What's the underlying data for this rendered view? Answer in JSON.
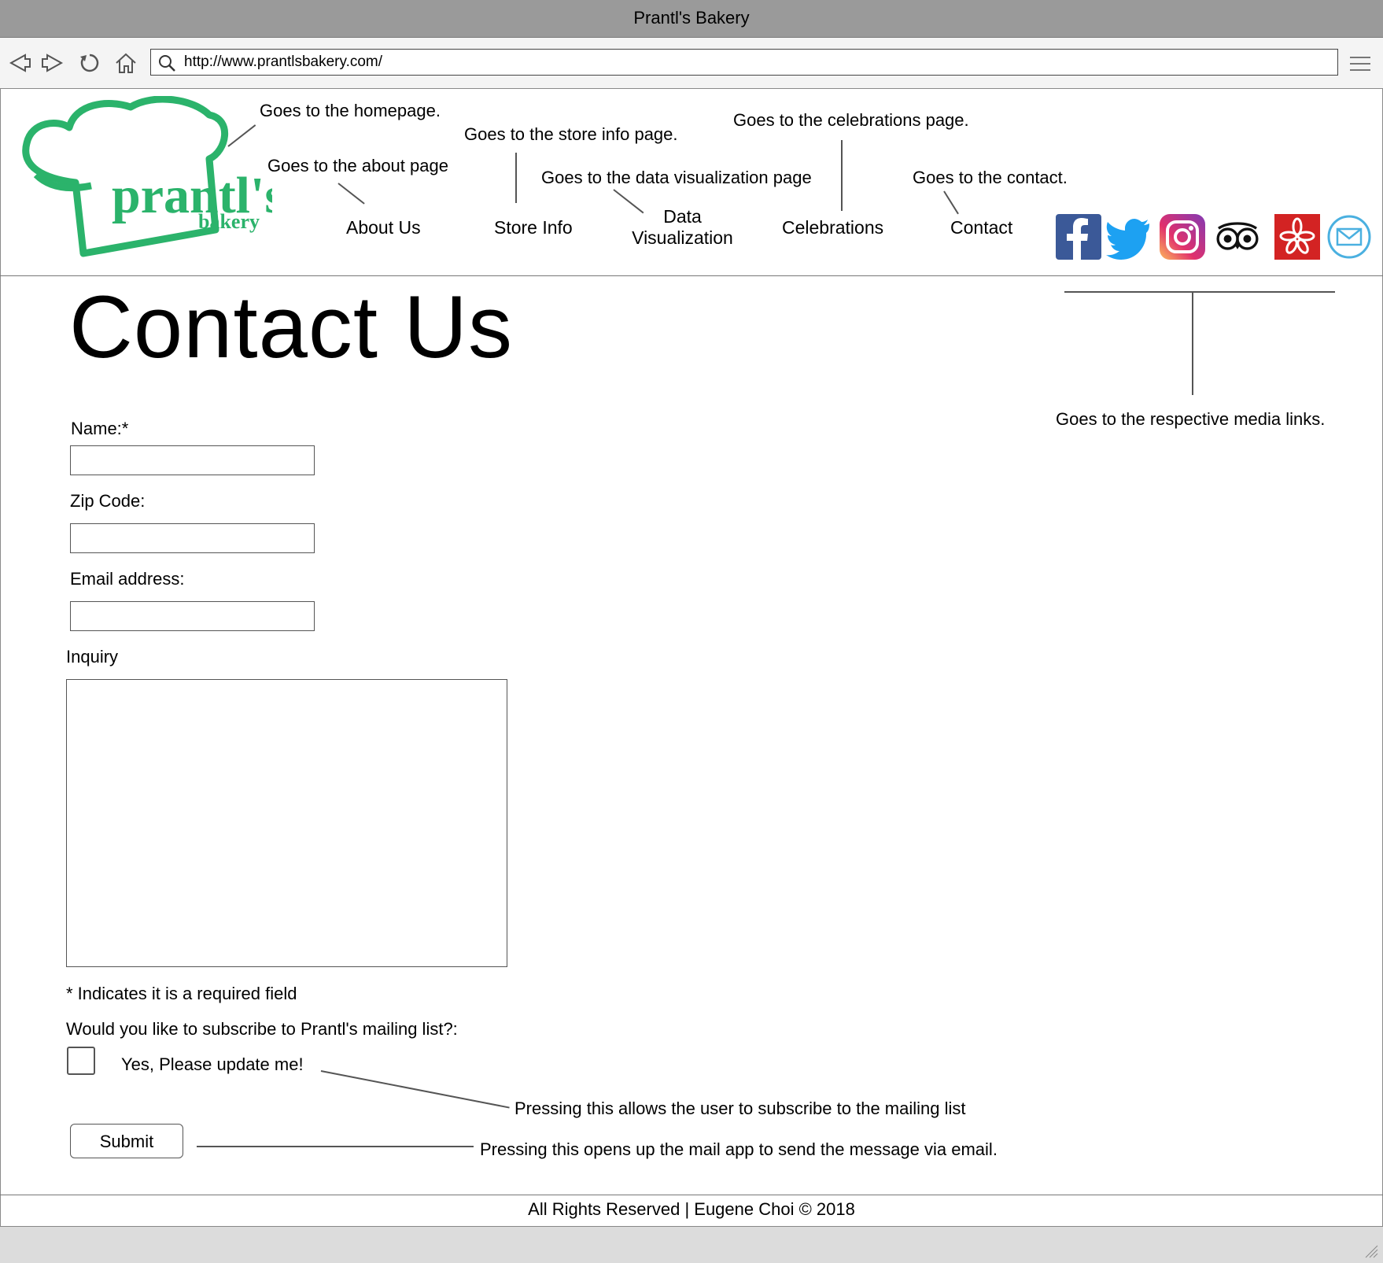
{
  "window": {
    "title": "Prantl's Bakery"
  },
  "browser": {
    "url": "http://www.prantlsbakery.com/"
  },
  "header": {
    "logo": {
      "brand": "prantl's",
      "sub": "bakery"
    },
    "nav": {
      "about": "About Us",
      "store": "Store Info",
      "dataviz_line1": "Data",
      "dataviz_line2": "Visualization",
      "celebrations": "Celebrations",
      "contact": "Contact"
    },
    "notes": {
      "home": "Goes to the homepage.",
      "about": "Goes to the about page",
      "store": "Goes to the store info page.",
      "dataviz": "Goes to the data visualization page",
      "celebrations": "Goes to the celebrations page.",
      "contact": "Goes to the contact.",
      "media": "Goes to the respective media links."
    },
    "social_icons": [
      "facebook-icon",
      "twitter-icon",
      "instagram-icon",
      "tripadvisor-icon",
      "yelp-icon",
      "email-icon"
    ]
  },
  "page": {
    "title": "Contact Us"
  },
  "form": {
    "name_label": "Name:*",
    "zip_label": "Zip Code:",
    "email_label": "Email address:",
    "inquiry_label": "Inquiry",
    "name_value": "",
    "zip_value": "",
    "email_value": "",
    "inquiry_value": "",
    "required_note": "* Indicates it is a required field",
    "subscribe_question": "Would you like to subscribe to Prantl's mailing list?:",
    "subscribe_option": "Yes, Please update me!",
    "subscribe_checked": false,
    "submit_label": "Submit",
    "subscribe_note": "Pressing this allows the user to subscribe to the mailing list",
    "submit_note": "Pressing this opens up the mail app to send the message via email."
  },
  "footer": {
    "text": "All Rights Reserved | Eugene Choi © 2018"
  },
  "colors": {
    "brand_green": "#2bb36b",
    "facebook": "#3b5998",
    "twitter": "#1da1f2",
    "yelp": "#d32323",
    "email": "#4ab0e0"
  }
}
